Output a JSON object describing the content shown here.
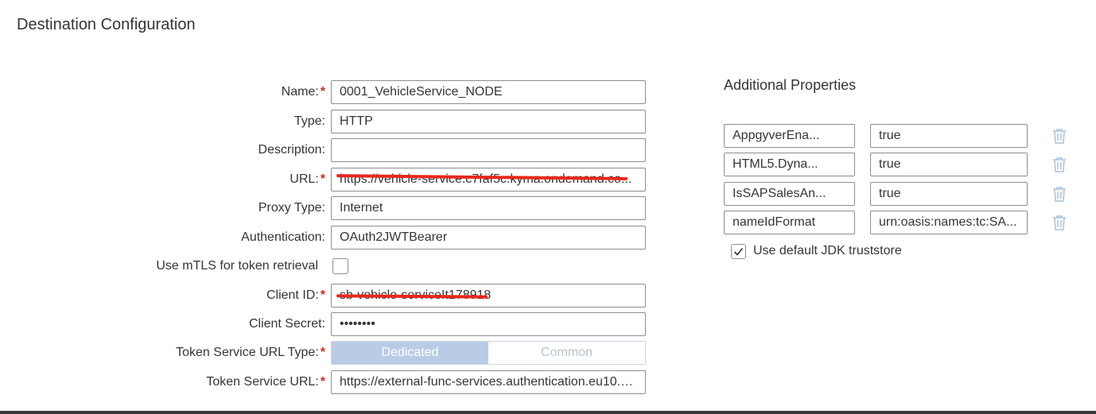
{
  "page_title": "Destination Configuration",
  "form": {
    "name": {
      "label": "Name:",
      "value": "0001_VehicleService_NODE",
      "required": "*"
    },
    "type": {
      "label": "Type:",
      "value": "HTTP"
    },
    "description": {
      "label": "Description:",
      "value": ""
    },
    "url": {
      "label": "URL:",
      "value": "https://vehicle-service.c7faf5c.kyma.ondemand.co...",
      "required": "*"
    },
    "proxy_type": {
      "label": "Proxy Type:",
      "value": "Internet"
    },
    "authentication": {
      "label": "Authentication:",
      "value": "OAuth2JWTBearer"
    },
    "use_mtls": {
      "label": "Use mTLS for token retrieval",
      "checked": false
    },
    "client_id": {
      "label": "Client ID:",
      "value": "sb-vehicle-service!t178918",
      "required": "*"
    },
    "client_secret": {
      "label": "Client Secret:",
      "value": "••••••••"
    },
    "token_service_url_type": {
      "label": "Token Service URL Type:",
      "required": "*",
      "options": [
        "Dedicated",
        "Common"
      ],
      "selected": "Dedicated"
    },
    "token_service_url": {
      "label": "Token Service URL:",
      "value": "https://external-func-services.authentication.eu10.h...",
      "required": "*"
    }
  },
  "additional_properties": {
    "title": "Additional Properties",
    "items": [
      {
        "key": "AppgyverEna...",
        "value": "true"
      },
      {
        "key": "HTML5.Dyna...",
        "value": "true"
      },
      {
        "key": "IsSAPSalesAn...",
        "value": "true"
      },
      {
        "key": "nameIdFormat",
        "value": "urn:oasis:names:tc:SA..."
      }
    ],
    "use_default_jdk": {
      "label": "Use default JDK truststore",
      "checked": true
    }
  },
  "colors": {
    "required": "#d9261c",
    "segment_active": "#b9cce5",
    "trash_icon": "#a9c3dd",
    "redaction": "#e8281c"
  }
}
